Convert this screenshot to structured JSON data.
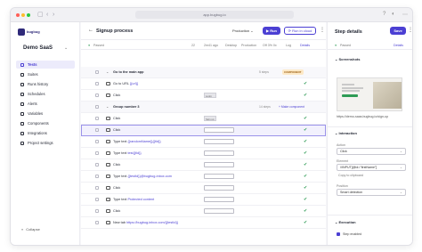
{
  "browser": {
    "url": "app.bugbug.io",
    "nav_back": "‹",
    "nav_forward": "›",
    "sidebar_toggle": "▢",
    "help": "?",
    "account": "◐",
    "menu": "⋯"
  },
  "sidebar": {
    "logo_text": "bugbug",
    "project": "Demo SaaS",
    "project_caret": "⌄",
    "items": [
      {
        "label": "Tests"
      },
      {
        "label": "Suites"
      },
      {
        "label": "Runs history"
      },
      {
        "label": "Schedules"
      },
      {
        "label": "Alerts"
      },
      {
        "label": "Variables"
      },
      {
        "label": "Components"
      },
      {
        "label": "Integrations"
      },
      {
        "label": "Project settings"
      }
    ],
    "collapse": "Collapse",
    "collapse_icon": "«"
  },
  "main": {
    "back": "←",
    "title": "Signup process",
    "environment": "Production ⌄",
    "run": "▶ Run",
    "run_cloud": "⟳ Run in cloud",
    "more": "⋮",
    "status": {
      "state": "Passed",
      "steps": "22",
      "viewport": "2m41 ago",
      "device": "Desktop",
      "profile": "Production",
      "browser": "Off 3% 0x",
      "clone": "Log",
      "details": "Details"
    },
    "rows": [
      {
        "type": "group",
        "label": "Go to the main app",
        "meta": "5 steps",
        "badge": "COMPONENT"
      },
      {
        "type": "step",
        "label_prefix": "Go to URL",
        "token": "{{url}}",
        "meta": "",
        "status": "✔"
      },
      {
        "type": "step",
        "label_prefix": "Click",
        "thumb": "Login",
        "status": "✔"
      },
      {
        "type": "group",
        "label": "Group number 3",
        "meta": "14 steps",
        "action": "+ Make component"
      },
      {
        "type": "step",
        "label_prefix": "Click",
        "thumb": "Sign up",
        "status": "✔"
      },
      {
        "type": "step",
        "label_prefix": "Click",
        "thumb": "",
        "status": "✔",
        "selected": true
      },
      {
        "type": "step",
        "label_prefix": "Type text",
        "token": "{{randomName}}{{tld}}",
        "thumb": "",
        "status": "✔"
      },
      {
        "type": "step",
        "label_prefix": "Type text",
        "token": "test{{tld}}",
        "thumb": "",
        "status": "✔"
      },
      {
        "type": "step",
        "label_prefix": "Click",
        "thumb": "",
        "status": "✔"
      },
      {
        "type": "step",
        "label_prefix": "Type text",
        "token": "{{testId}}@bugbug-inbox.com",
        "thumb": "",
        "status": "✔"
      },
      {
        "type": "step",
        "label_prefix": "Click",
        "thumb": "",
        "status": "✔"
      },
      {
        "type": "step",
        "label_prefix": "Type text",
        "token": "Protected content",
        "thumb": "",
        "status": "✔"
      },
      {
        "type": "step",
        "label_prefix": "Click",
        "thumb": "",
        "status": "✔"
      },
      {
        "type": "step",
        "label_prefix": "New tab",
        "token": "https://bugbug-inbox.com/{{testId}}",
        "thumb": "",
        "status": "✔"
      }
    ]
  },
  "panel": {
    "title": "Step details",
    "save": "Save",
    "more": "⋮",
    "status": "Passed",
    "details": "Details",
    "screenshots": "Screenshots",
    "shot_url": "https://demo-saas.bugbug.io/sign-up",
    "interaction": "Interaction",
    "action_label": "Action",
    "action_value": "Click",
    "element_label": "Element",
    "element_value": "//INPUT[@id=\"firstName\"]",
    "copy_clipboard": "Copy to clipboard",
    "position_label": "Position",
    "position_value": "Smart detection",
    "execution": "Execution",
    "step_enabled": "Step enabled"
  },
  "colors": {
    "accent": "#4b3fd3",
    "success": "#2e9b55",
    "component_badge": "#fde9c7"
  }
}
